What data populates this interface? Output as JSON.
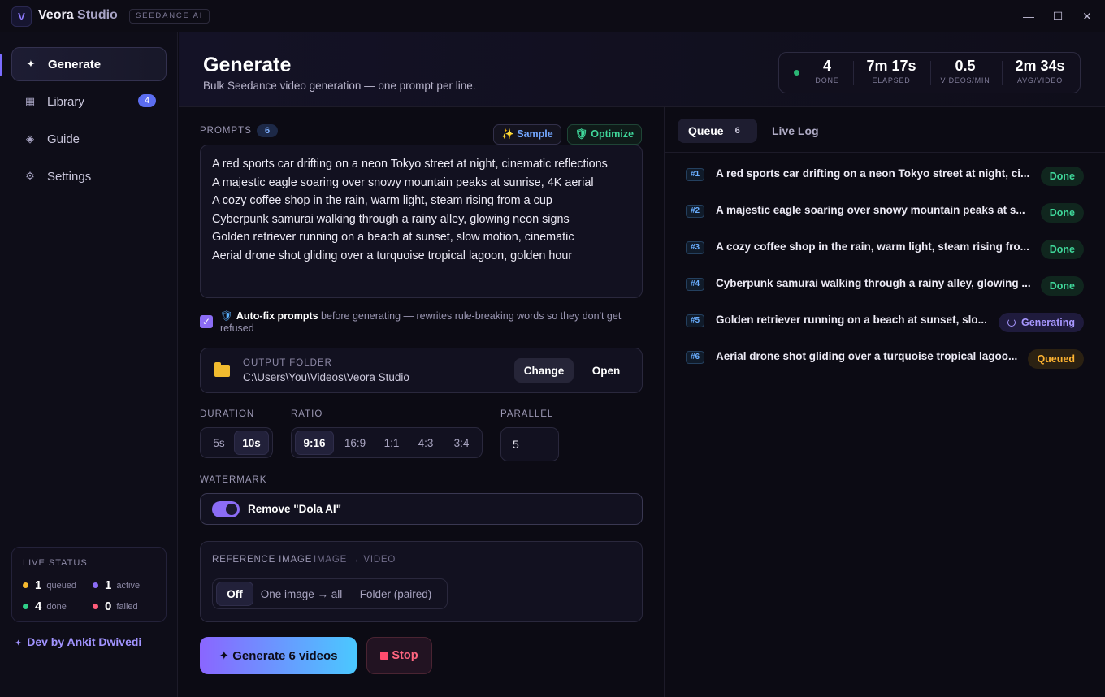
{
  "titlebar": {
    "logo_letter": "V",
    "app_name": "Veora",
    "app_name_suffix": " Studio",
    "badge": "SEEDANCE AI",
    "minimize": "—",
    "maximize": "☐",
    "close": "✕"
  },
  "sidebar": {
    "items": [
      {
        "label": "Generate",
        "icon": "sparkle-icon",
        "glyph": "✦",
        "active": true
      },
      {
        "label": "Library",
        "icon": "grid-icon",
        "glyph": "▦",
        "count": "4"
      },
      {
        "label": "Guide",
        "icon": "diamond-icon",
        "glyph": "◈"
      },
      {
        "label": "Settings",
        "icon": "gear-icon",
        "glyph": "⚙"
      }
    ],
    "live_status": {
      "title": "LIVE STATUS",
      "queued": {
        "num": "1",
        "label": "queued",
        "color": "#f5b82e"
      },
      "active": {
        "num": "1",
        "label": "active",
        "color": "#8b6cf5"
      },
      "done": {
        "num": "4",
        "label": "done",
        "color": "#2fcf88"
      },
      "failed": {
        "num": "0",
        "label": "failed",
        "color": "#ff5c7a"
      }
    },
    "credit": "Dev by Ankit Dwivedi"
  },
  "header": {
    "title": "Generate",
    "subtitle": "Bulk Seedance video generation — one prompt per line.",
    "stats": [
      {
        "value": "4",
        "label": "DONE"
      },
      {
        "value": "7m 17s",
        "label": "ELAPSED"
      },
      {
        "value": "0.5",
        "label": "VIDEOS/MIN"
      },
      {
        "value": "2m 34s",
        "label": "AVG/VIDEO"
      }
    ]
  },
  "prompts": {
    "label": "PROMPTS",
    "count": "6",
    "sample_label": "✨ Sample",
    "optimize_label": "🛡 Optimize",
    "lines": [
      "A red sports car drifting on a neon Tokyo street at night, cinematic reflections",
      "A majestic eagle soaring over snowy mountain peaks at sunrise, 4K aerial",
      "A cozy coffee shop in the rain, warm light, steam rising from a cup",
      "Cyberpunk samurai walking through a rainy alley, glowing neon signs",
      "Golden retriever running on a beach at sunset, slow motion, cinematic",
      "Aerial drone shot gliding over a turquoise tropical lagoon, golden hour"
    ]
  },
  "autofix": {
    "checked": true,
    "bold": "Auto-fix prompts",
    "rest": " before generating — rewrites rule-breaking words so they don't get refused"
  },
  "output_folder": {
    "label": "OUTPUT FOLDER",
    "path": "C:\\Users\\You\\Videos\\Veora Studio",
    "change_label": "Change",
    "open_label": "Open"
  },
  "duration": {
    "label": "DURATION",
    "options": [
      "5s",
      "10s"
    ],
    "selected": "10s"
  },
  "ratio": {
    "label": "RATIO",
    "options": [
      "9:16",
      "16:9",
      "1:1",
      "4:3",
      "3:4"
    ],
    "selected": "9:16"
  },
  "parallel": {
    "label": "PARALLEL",
    "value": "5"
  },
  "watermark": {
    "label": "WATERMARK",
    "toggle_label": "Remove \"Dola AI\"",
    "enabled": true
  },
  "reference_image": {
    "title": "REFERENCE IMAGE",
    "subtitle": "IMAGE → VIDEO",
    "options": [
      "Off",
      "One image → all",
      "Folder (paired)"
    ],
    "selected": "Off"
  },
  "actions": {
    "generate_label": "✦ Generate 6 videos",
    "stop_label": "Stop"
  },
  "right_panel": {
    "tabs": {
      "queue_label": "Queue",
      "queue_count": "6",
      "log_label": "Live Log"
    },
    "queue": [
      {
        "num": "#1",
        "text": "A red sports car drifting on a neon Tokyo street at night, ci...",
        "status": "Done"
      },
      {
        "num": "#2",
        "text": "A majestic eagle soaring over snowy mountain peaks at s...",
        "status": "Done"
      },
      {
        "num": "#3",
        "text": "A cozy coffee shop in the rain, warm light, steam rising fro...",
        "status": "Done"
      },
      {
        "num": "#4",
        "text": "Cyberpunk samurai walking through a rainy alley, glowing ...",
        "status": "Done"
      },
      {
        "num": "#5",
        "text": "Golden retriever running on a beach at sunset, slo...",
        "status": "Generating"
      },
      {
        "num": "#6",
        "text": "Aerial drone shot gliding over a turquoise tropical lagoo...",
        "status": "Queued"
      }
    ]
  }
}
